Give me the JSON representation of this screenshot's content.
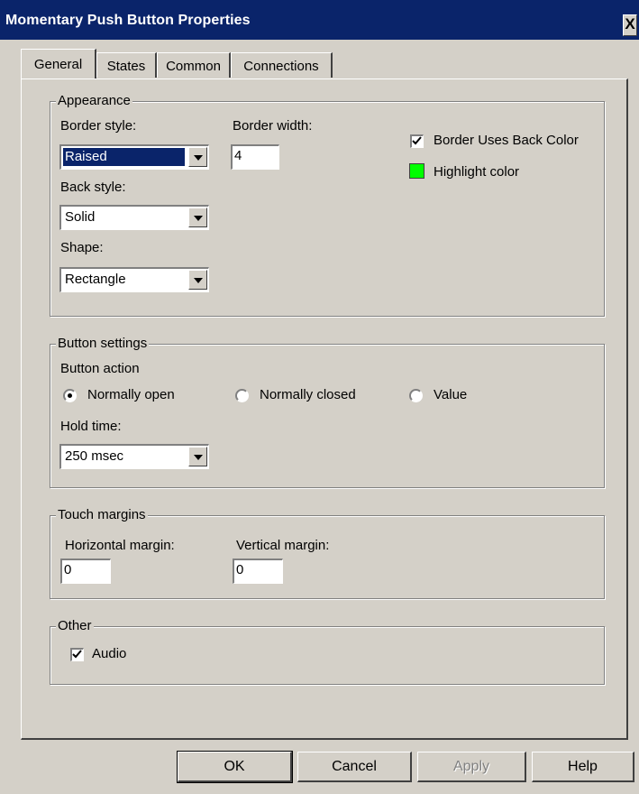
{
  "window": {
    "title": "Momentary Push Button Properties",
    "close_label": "X"
  },
  "tabs": [
    {
      "label": "General"
    },
    {
      "label": "States"
    },
    {
      "label": "Common"
    },
    {
      "label": "Connections"
    }
  ],
  "appearance": {
    "legend": "Appearance",
    "border_style": {
      "label": "Border style:",
      "value": "Raised"
    },
    "border_width": {
      "label": "Border width:",
      "value": "4"
    },
    "back_style": {
      "label": "Back style:",
      "value": "Solid"
    },
    "shape": {
      "label": "Shape:",
      "value": "Rectangle"
    },
    "border_uses_back_color": {
      "label": "Border Uses Back Color",
      "checked": true
    },
    "highlight_color": {
      "label": "Highlight color",
      "color": "#00ff00"
    }
  },
  "button_settings": {
    "legend": "Button settings",
    "action_label": "Button action",
    "options": [
      {
        "label": "Normally open",
        "selected": true
      },
      {
        "label": "Normally closed",
        "selected": false
      },
      {
        "label": "Value",
        "selected": false
      }
    ],
    "hold_time": {
      "label": "Hold time:",
      "value": "250 msec"
    }
  },
  "touch_margins": {
    "legend": "Touch margins",
    "horizontal": {
      "label": "Horizontal margin:",
      "value": "0"
    },
    "vertical": {
      "label": "Vertical margin:",
      "value": "0"
    }
  },
  "other": {
    "legend": "Other",
    "audio": {
      "label": "Audio",
      "checked": true
    }
  },
  "footer": {
    "ok": "OK",
    "cancel": "Cancel",
    "apply": "Apply",
    "help": "Help"
  },
  "colors": {
    "titlebar": "#0a246a",
    "face": "#d4d0c8",
    "highlight_swatch": "#00ff00",
    "selection": "#0a246a"
  },
  "icons": [
    "close-icon",
    "dropdown-arrow-icon",
    "checkmark-icon",
    "radio-dot-icon"
  ]
}
